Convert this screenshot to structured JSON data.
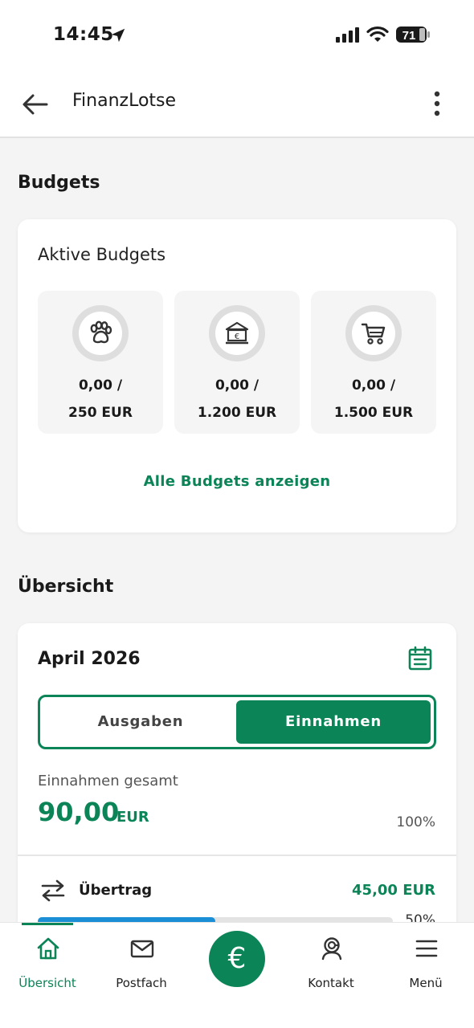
{
  "status_bar": {
    "time": "14:45",
    "battery": "71"
  },
  "app_bar": {
    "title": "FinanzLotse"
  },
  "budgets_section": {
    "title": "Budgets",
    "card_title": "Aktive Budgets",
    "tiles": [
      {
        "icon": "paw-icon",
        "amount_line1": "0,00 /",
        "amount_line2": "250 EUR"
      },
      {
        "icon": "bank-icon",
        "amount_line1": "0,00 /",
        "amount_line2": "1.200 EUR"
      },
      {
        "icon": "cart-icon",
        "amount_line1": "0,00 /",
        "amount_line2": "1.500 EUR"
      }
    ],
    "show_all_link": "Alle Budgets anzeigen"
  },
  "overview_section": {
    "title": "Übersicht",
    "month": "April 2026",
    "toggle": {
      "left": "Ausgaben",
      "right": "Einnahmen",
      "selected": "Einnahmen"
    },
    "total_label": "Einnahmen gesamt",
    "total_value": "90,00",
    "total_currency": "EUR",
    "total_percent": "100%",
    "rows": [
      {
        "icon": "transfer-icon",
        "label": "Übertrag",
        "amount": "45,00 EUR",
        "percent": "50%",
        "progress": 0.5,
        "color": "#1a8fd6"
      }
    ]
  },
  "bottom_nav": {
    "items": [
      {
        "label": "Übersicht",
        "icon": "home-icon",
        "active": true
      },
      {
        "label": "Postfach",
        "icon": "mail-icon",
        "active": false
      },
      {
        "label": "",
        "icon": "euro-icon",
        "active": false
      },
      {
        "label": "Kontakt",
        "icon": "contact-icon",
        "active": false
      },
      {
        "label": "Menü",
        "icon": "menu-icon",
        "active": false
      }
    ],
    "fab_symbol": "€"
  },
  "colors": {
    "accent": "#0b8457",
    "progress": "#1a8fd6"
  }
}
